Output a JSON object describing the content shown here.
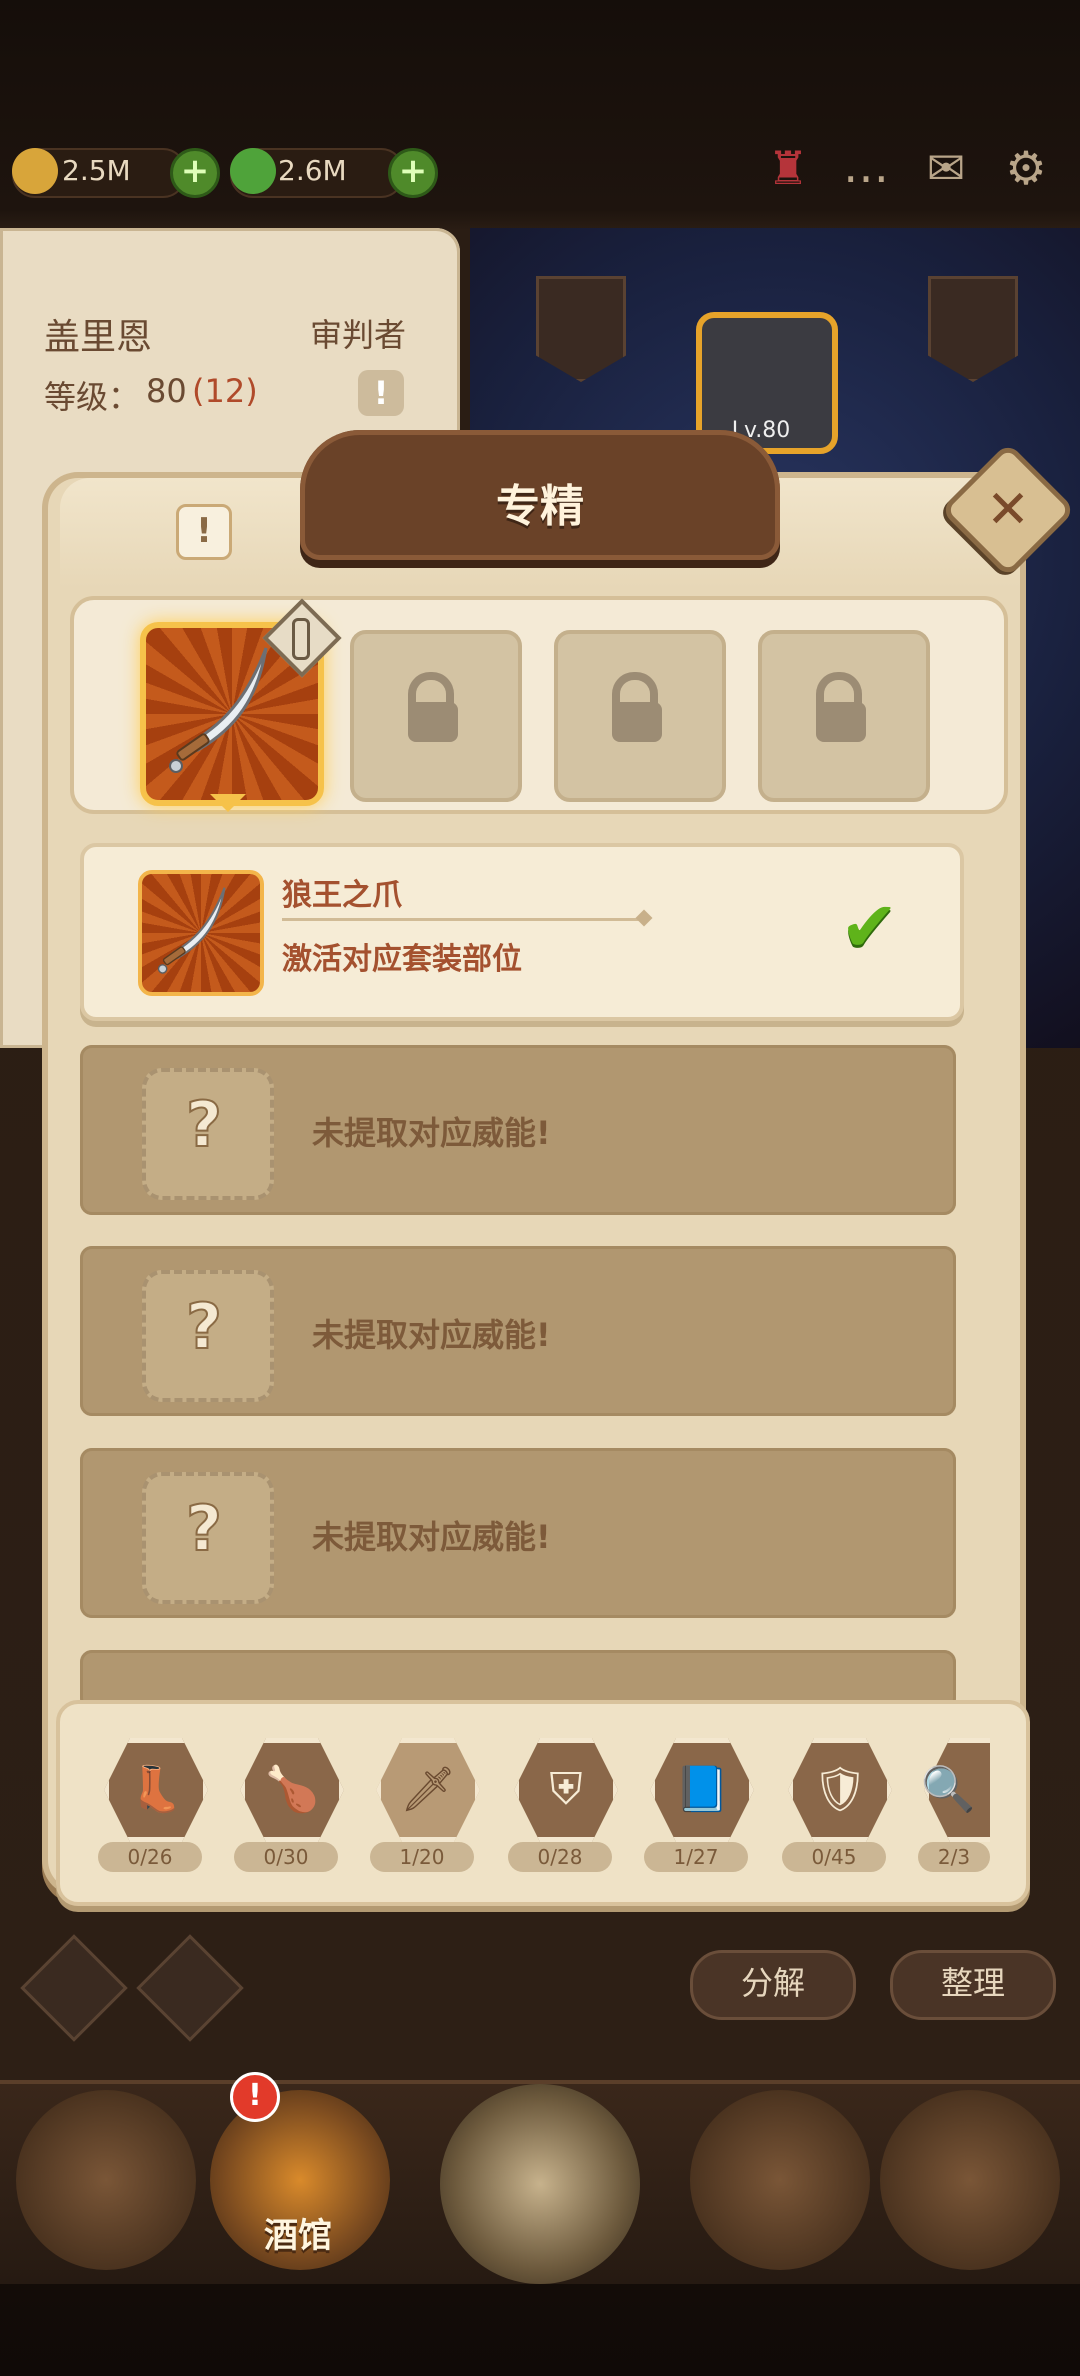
{
  "resources": [
    {
      "name": "gold",
      "value": "2.5M",
      "color": "#d8a53a"
    },
    {
      "name": "crystal",
      "value": "2.6M",
      "color": "#4fa33a"
    }
  ],
  "top_icons": [
    "horn-icon",
    "chat-icon",
    "mail-icon",
    "gear-icon"
  ],
  "hero": {
    "name": "盖里恩",
    "class": "审判者",
    "level_label": "等级：",
    "level": "80",
    "level_bonus": "(12)",
    "gear_level": "Lv.80"
  },
  "modal": {
    "title": "专精",
    "selected_item": {
      "name": "狼王之爪",
      "description": "激活对应套装部位"
    },
    "locked_text": "未提取对应威能!",
    "locked_count_visible": 3,
    "tabs": [
      {
        "icon": "boot-icon",
        "glyph": "👢",
        "count": "0/26"
      },
      {
        "icon": "drumstick-icon",
        "glyph": "🍗",
        "count": "0/30"
      },
      {
        "icon": "dagger-icon",
        "glyph": "🗡",
        "count": "1/20"
      },
      {
        "icon": "shield-icon",
        "glyph": "⛨",
        "count": "0/28"
      },
      {
        "icon": "book-icon",
        "glyph": "📘",
        "count": "1/27"
      },
      {
        "icon": "armor-icon",
        "glyph": "🛡",
        "count": "0/45"
      },
      {
        "icon": "magnifier-icon",
        "glyph": "🔍",
        "count": "2/3"
      }
    ]
  },
  "actions": {
    "decompose": "分解",
    "organize": "整理"
  },
  "nav": {
    "tavern_label": "酒馆",
    "badge": "!"
  }
}
